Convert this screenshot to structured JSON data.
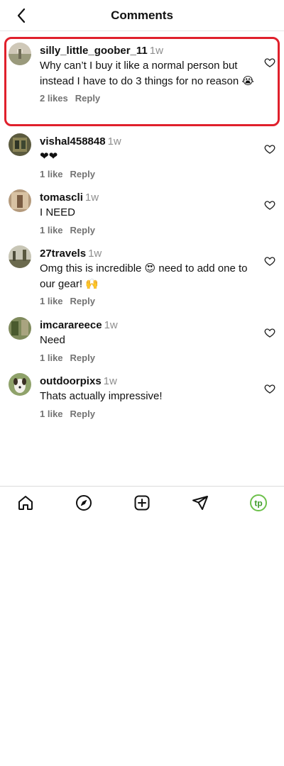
{
  "header": {
    "title": "Comments"
  },
  "comments": [
    {
      "username": "silly_little_goober_11",
      "time": "1w",
      "text": "Why can’t I buy it like a normal person but instead I have to do 3 things for no reason 😭",
      "likes": "2 likes",
      "reply": "Reply"
    },
    {
      "username": "vishal458848",
      "time": "1w",
      "text": "❤❤",
      "likes": "1 like",
      "reply": "Reply"
    },
    {
      "username": "tomascli",
      "time": "1w",
      "text": "I NEED",
      "likes": "1 like",
      "reply": "Reply"
    },
    {
      "username": "27travels",
      "time": "1w",
      "text": "Omg this is incredible 😍 need to add one to our gear! 🙌",
      "likes": "1 like",
      "reply": "Reply"
    },
    {
      "username": "imcarareece",
      "time": "1w",
      "text": "Need",
      "likes": "1 like",
      "reply": "Reply"
    },
    {
      "username": "outdoorpixs",
      "time": "1w",
      "text": "Thats actually impressive!",
      "likes": "1 like",
      "reply": "Reply"
    }
  ],
  "bottom_nav": {
    "items": [
      "home-icon",
      "compass-icon",
      "plus-square-icon",
      "send-icon",
      "profile-avatar"
    ],
    "profile_initials": "tp",
    "profile_color": "#6cc04a"
  },
  "highlight_color": "#e0202c"
}
